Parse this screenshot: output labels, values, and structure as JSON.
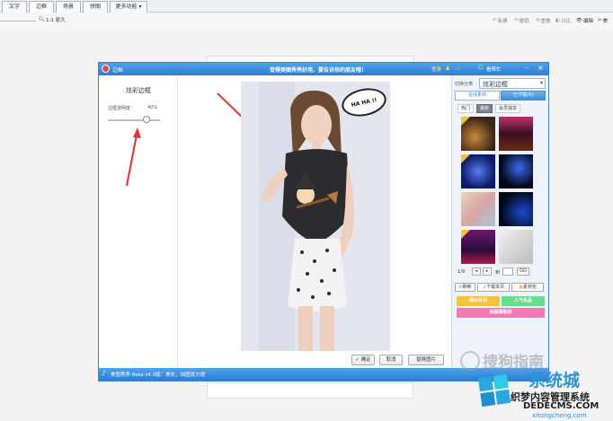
{
  "toolbar": {
    "tabs": [
      "文字",
      "边框",
      "场景",
      "拼图",
      "更多功能"
    ],
    "zoom": "1:1 原大",
    "actions": {
      "new": "新建",
      "undo": "撤销",
      "reset": "重做",
      "compare": "对比",
      "edit": "编辑",
      "more": "美"
    }
  },
  "dialog": {
    "title": "边框",
    "banner": "觉得美图秀秀好用，要告诉你的朋友哦！",
    "account": "登录",
    "check_update": "看帮忙",
    "status_text": "美图秀秀 Beta v4.0版：美化，拍图就方便",
    "left": {
      "heading": "炫彩边框",
      "slider_label": "边框透明度：",
      "slider_value": "40%",
      "slider_fraction": 0.4
    },
    "buttons": {
      "confirm": "确定",
      "cancel": "取消",
      "replace": "替换图片"
    },
    "right": {
      "category_label": "切换分类",
      "category_value": "炫彩边框",
      "tabs": [
        "在线素材",
        "已下载(4)"
      ],
      "subtabs": [
        "热门",
        "最新",
        "会员独享"
      ],
      "pagination": {
        "page": "1/9",
        "goto": "到",
        "go": "GO"
      },
      "actions": [
        "刷新",
        "下载本页",
        "素材包"
      ],
      "categories": [
        {
          "label": "婚纱系列",
          "color": "#f4c23d"
        },
        {
          "label": "人气名品",
          "color": "#6bdc8c"
        },
        {
          "label": "美颜精装饰",
          "color": "#f37ab4"
        }
      ]
    },
    "photo": {
      "sticker_text": "HA HA !!"
    }
  },
  "watermarks": {
    "sogou": "搜狗指南",
    "site_main": "系统城",
    "site_sub": "织梦内容管理系统",
    "site_url": "DEDECMS.COM",
    "site_url2": "xitongcheng.com"
  },
  "colors": {
    "accent": "#2b7ed3",
    "arrow": "#e23232"
  }
}
